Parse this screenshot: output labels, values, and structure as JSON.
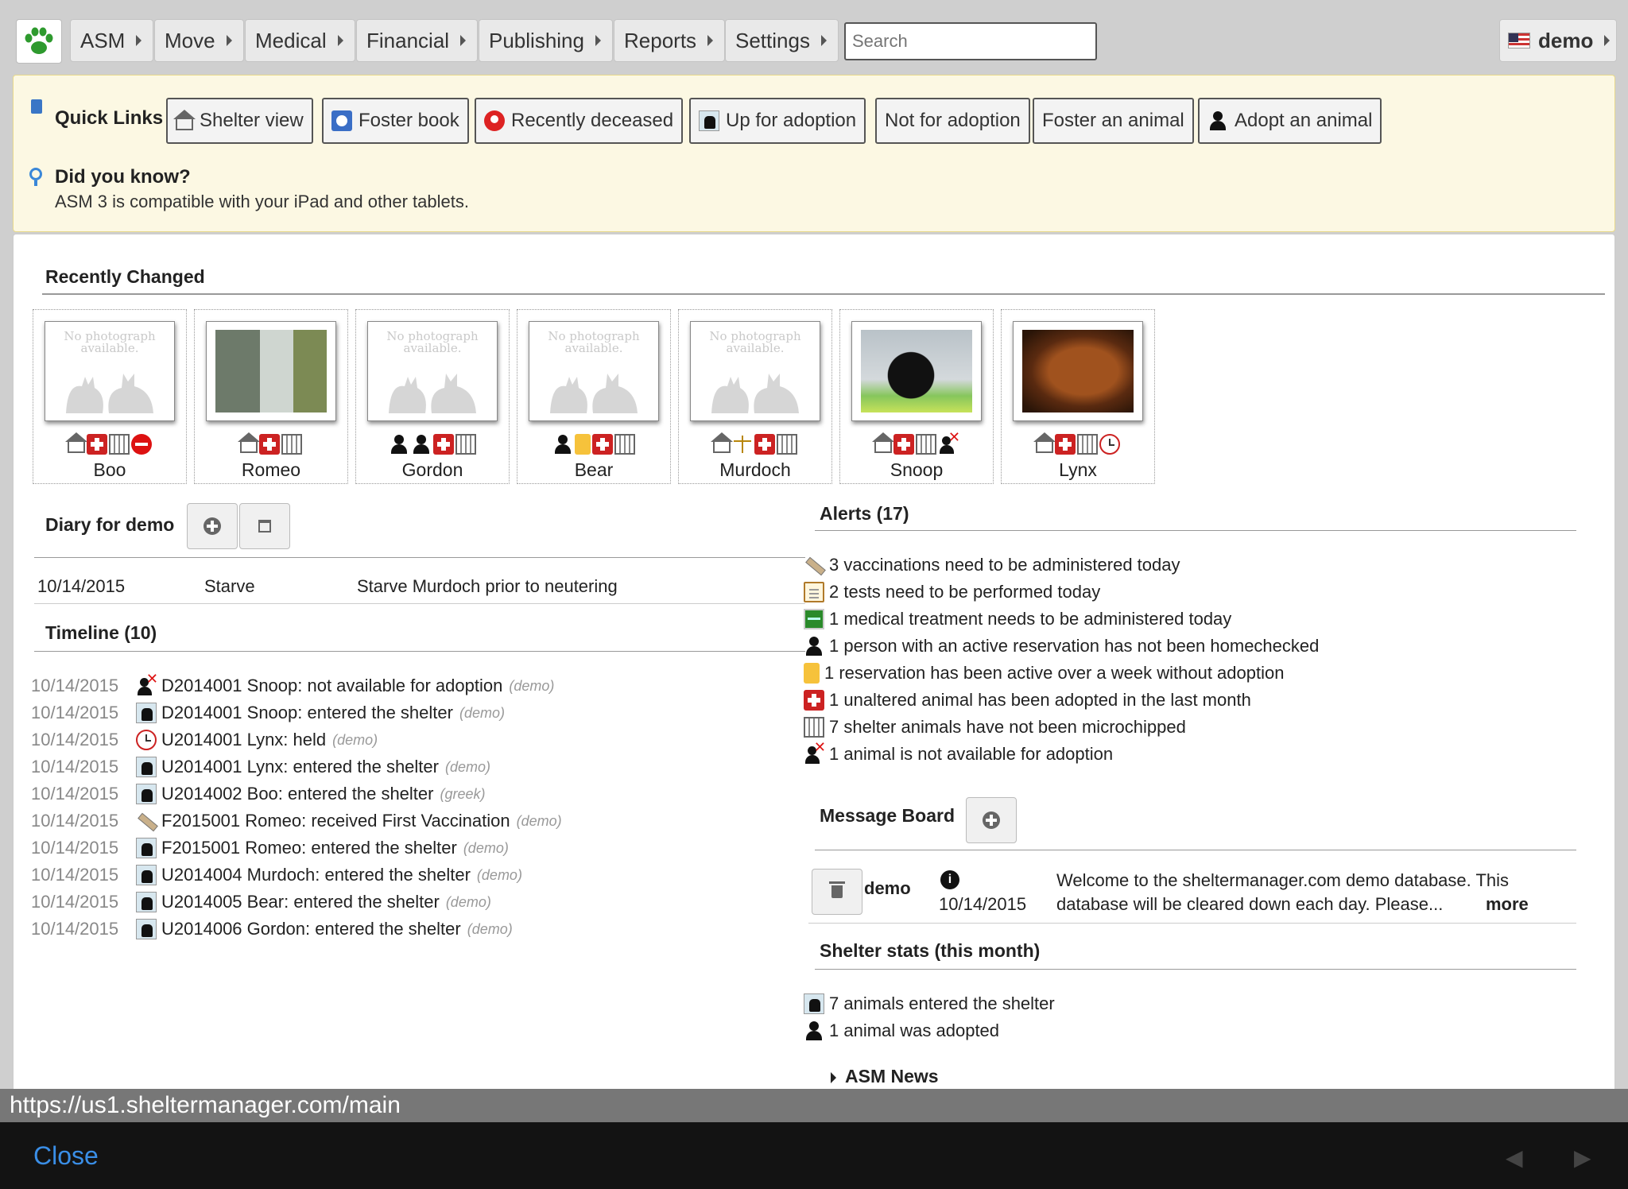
{
  "menu": {
    "items": [
      "ASM",
      "Move",
      "Medical",
      "Financial",
      "Publishing",
      "Reports",
      "Settings"
    ],
    "search_placeholder": "Search",
    "user": "demo"
  },
  "quick_links": {
    "title": "Quick Links",
    "links": [
      "Shelter view",
      "Foster book",
      "Recently deceased",
      "Up for adoption",
      "Not for adoption",
      "Foster an animal",
      "Adopt an animal"
    ]
  },
  "did_you_know": {
    "title": "Did you know?",
    "text": "ASM 3 is compatible with your iPad and other tablets."
  },
  "recently_changed": {
    "title": "Recently Changed",
    "no_photo_text": "No photograph available.",
    "animals": [
      {
        "name": "Boo",
        "photo": "none",
        "icons": [
          "house-icon",
          "medical-icon",
          "microchip-icon",
          "not-available-icon"
        ]
      },
      {
        "name": "Romeo",
        "photo": "cat-window",
        "icons": [
          "house-icon",
          "medical-icon",
          "microchip-icon"
        ]
      },
      {
        "name": "Gordon",
        "photo": "none",
        "icons": [
          "adoption-icon",
          "person-info-icon",
          "medical-icon",
          "microchip-icon"
        ]
      },
      {
        "name": "Bear",
        "photo": "none",
        "icons": [
          "person-icon",
          "reservation-icon",
          "medical-icon",
          "microchip-icon"
        ]
      },
      {
        "name": "Murdoch",
        "photo": "none",
        "icons": [
          "house-icon",
          "scale-icon",
          "medical-icon",
          "microchip-icon"
        ]
      },
      {
        "name": "Snoop",
        "photo": "dog-car",
        "icons": [
          "house-icon",
          "medical-icon",
          "microchip-icon",
          "not-for-adoption-icon"
        ]
      },
      {
        "name": "Lynx",
        "photo": "brown-dog",
        "icons": [
          "house-icon",
          "medical-icon",
          "microchip-icon",
          "held-icon"
        ]
      }
    ]
  },
  "diary": {
    "title": "Diary for demo",
    "rows": [
      {
        "date": "10/14/2015",
        "subject": "Starve",
        "note": "Starve Murdoch prior to neutering"
      }
    ]
  },
  "timeline": {
    "title": "Timeline (10)",
    "rows": [
      {
        "date": "10/14/2015",
        "icon": "not-for-adoption-icon",
        "text": "D2014001 Snoop: not available for adoption",
        "user": "(demo)"
      },
      {
        "date": "10/14/2015",
        "icon": "entered-shelter-icon",
        "text": "D2014001 Snoop: entered the shelter",
        "user": "(demo)"
      },
      {
        "date": "10/14/2015",
        "icon": "held-icon",
        "text": "U2014001 Lynx: held",
        "user": "(demo)"
      },
      {
        "date": "10/14/2015",
        "icon": "entered-shelter-icon",
        "text": "U2014001 Lynx: entered the shelter",
        "user": "(demo)"
      },
      {
        "date": "10/14/2015",
        "icon": "entered-shelter-icon",
        "text": "U2014002 Boo: entered the shelter",
        "user": "(greek)"
      },
      {
        "date": "10/14/2015",
        "icon": "vaccination-icon",
        "text": "F2015001 Romeo: received First Vaccination",
        "user": "(demo)"
      },
      {
        "date": "10/14/2015",
        "icon": "entered-shelter-icon",
        "text": "F2015001 Romeo: entered the shelter",
        "user": "(demo)"
      },
      {
        "date": "10/14/2015",
        "icon": "entered-shelter-icon",
        "text": "U2014004 Murdoch: entered the shelter",
        "user": "(demo)"
      },
      {
        "date": "10/14/2015",
        "icon": "entered-shelter-icon",
        "text": "U2014005 Bear: entered the shelter",
        "user": "(demo)"
      },
      {
        "date": "10/14/2015",
        "icon": "entered-shelter-icon",
        "text": "U2014006 Gordon: entered the shelter",
        "user": "(demo)"
      }
    ]
  },
  "alerts": {
    "title": "Alerts (17)",
    "rows": [
      {
        "icon": "vaccination-icon",
        "text": "3 vaccinations need to be administered today"
      },
      {
        "icon": "test-icon",
        "text": "2 tests need to be performed today"
      },
      {
        "icon": "treatment-icon",
        "text": "1 medical treatment needs to be administered today"
      },
      {
        "icon": "person-icon",
        "text": "1 person with an active reservation has not been homechecked"
      },
      {
        "icon": "reservation-icon",
        "text": "1 reservation has been active over a week without adoption"
      },
      {
        "icon": "medical-icon",
        "text": "1 unaltered animal has been adopted in the last month"
      },
      {
        "icon": "microchip-icon",
        "text": "7 shelter animals have not been microchipped"
      },
      {
        "icon": "not-for-adoption-icon",
        "text": "1 animal is not available for adoption"
      }
    ]
  },
  "message_board": {
    "title": "Message Board",
    "messages": [
      {
        "author": "demo",
        "date": "10/14/2015",
        "text_line1": "Welcome to the sheltermanager.com demo database. This",
        "text_line2": "database will be cleared down each day. Please...",
        "more": "more"
      }
    ]
  },
  "stats": {
    "title": "Shelter stats (this month)",
    "rows": [
      {
        "icon": "entered-shelter-icon",
        "text": "7 animals entered the shelter"
      },
      {
        "icon": "adoption-icon",
        "text": "1 animal was adopted"
      }
    ]
  },
  "news": {
    "title": "ASM News"
  },
  "status_url": "https://us1.sheltermanager.com/main",
  "bottom": {
    "close": "Close",
    "back": "◀",
    "forward": "▶"
  }
}
